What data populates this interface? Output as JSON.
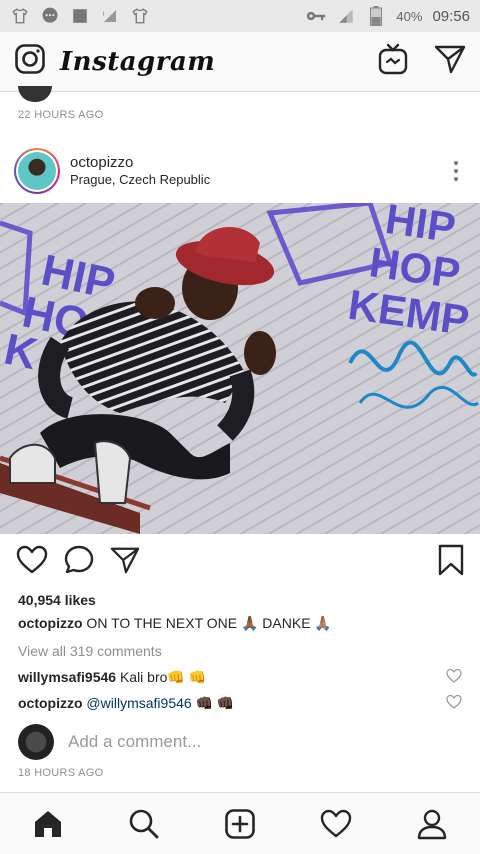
{
  "status_bar": {
    "battery": "40%",
    "time": "09:56"
  },
  "app_bar": {
    "brand": "Instagram",
    "icons": [
      "camera-icon",
      "igtv-icon",
      "direct-message-icon"
    ]
  },
  "previous_post": {
    "time_ago": "22 HOURS AGO"
  },
  "post": {
    "username": "octopizzo",
    "location": "Prague, Czech Republic",
    "likes": "40,954 likes",
    "caption_user": "octopizzo",
    "caption_text": " ON TO THE NEXT ONE 🙏🏾 DANKE 🙏🏽",
    "view_all": "View all 319 comments",
    "comments": [
      {
        "user": "willymsafi9546",
        "text": " Kali bro👊 👊"
      },
      {
        "user": "octopizzo",
        "mention": " @willymsafi9546",
        "text": " 👊🏿 👊🏿"
      }
    ],
    "add_comment_placeholder": "Add a comment...",
    "time_ago": "18 HOURS AGO",
    "photo": {
      "sign_text": "HIP HOP KEMP",
      "sign_text_left": "HIP HOP K"
    }
  },
  "bottom_nav": [
    "home-icon",
    "search-icon",
    "new-post-icon",
    "activity-heart-icon",
    "profile-icon"
  ]
}
